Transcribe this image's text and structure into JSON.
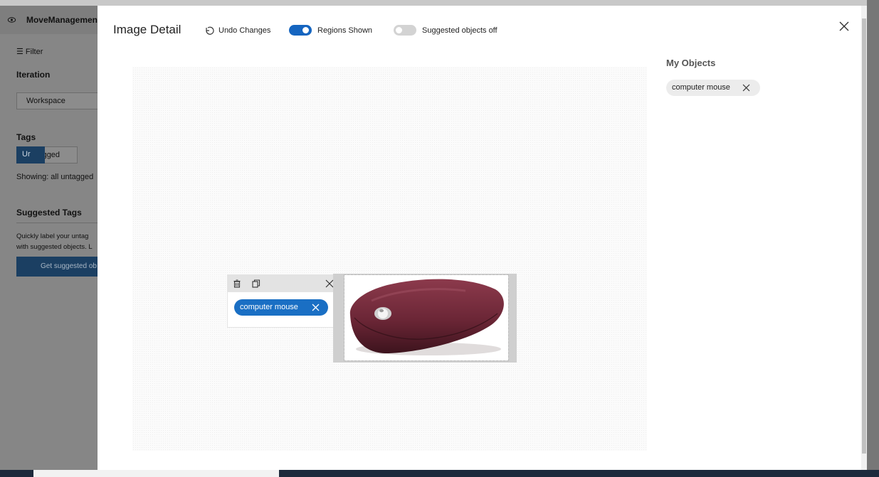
{
  "background": {
    "app_name": "MoveManagemen",
    "filter_label": "Filter",
    "iteration_label": "Iteration",
    "workspace_value": "Workspace",
    "tags_label": "Tags",
    "tagged_button": "Tagged",
    "untagged_button": "Ur",
    "showing_text": "Showing: all untagged",
    "suggested_tags_label": "Suggested Tags",
    "quick_text_line1": "Quickly label your untag",
    "quick_text_line2": "with suggested objects. L",
    "get_suggested_button": "Get suggested ob"
  },
  "modal": {
    "title": "Image Detail",
    "undo_label": "Undo Changes",
    "regions_toggle": {
      "label": "Regions Shown",
      "on": true
    },
    "suggested_toggle": {
      "label": "Suggested objects off",
      "on": false
    },
    "region_tag": "computer mouse",
    "my_objects_title": "My Objects",
    "my_objects": [
      "computer mouse"
    ]
  },
  "colors": {
    "accent": "#1a6fc4",
    "chip_bg": "#ececec"
  }
}
